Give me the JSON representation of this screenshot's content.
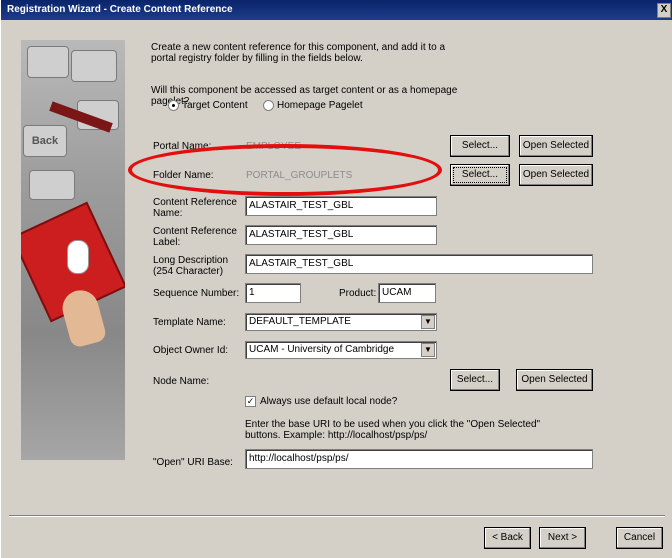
{
  "window": {
    "title": "Registration Wizard - Create Content Reference",
    "close": "X"
  },
  "intro": "Create a new content reference for this component, and add it to a portal registry folder by filling in the fields below.",
  "access_question": "Will this component be accessed as target content or as a homepage pagelet?",
  "radio": {
    "target": "Target Content",
    "homepage": "Homepage Pagelet",
    "selected": "target"
  },
  "portal_name": {
    "label": "Portal Name:",
    "value": "EMPLOYEE"
  },
  "folder_name": {
    "label": "Folder Name:",
    "value": "PORTAL_GROUPLETS"
  },
  "buttons": {
    "select": "Select...",
    "open_selected": "Open Selected"
  },
  "content_ref_name": {
    "label": "Content Reference Name:",
    "value": "ALASTAIR_TEST_GBL"
  },
  "content_ref_label": {
    "label": "Content Reference Label:",
    "value": "ALASTAIR_TEST_GBL"
  },
  "long_description": {
    "label": "Long Description (254 Character)",
    "value": "ALASTAIR_TEST_GBL"
  },
  "sequence_number": {
    "label": "Sequence Number:",
    "value": "1"
  },
  "product": {
    "label": "Product:",
    "value": "UCAM"
  },
  "template_name": {
    "label": "Template Name:",
    "value": "DEFAULT_TEMPLATE"
  },
  "object_owner": {
    "label": "Object Owner Id:",
    "value": "UCAM - University of Cambridge"
  },
  "node_name": {
    "label": "Node Name:"
  },
  "default_node": {
    "label": "Always use default local node?",
    "checked": true
  },
  "uri_help": "Enter the base URI to be used when you click the \"Open Selected\" buttons. Example: http://localhost/psp/ps/",
  "uri_base": {
    "label": "\"Open\" URI Base:",
    "value": "http://localhost/psp/ps/"
  },
  "footer": {
    "back": "< Back",
    "next": "Next >",
    "cancel": "Cancel"
  },
  "side_image": {
    "key_label": "Back"
  },
  "colors": {
    "titlebar": "#0a246a",
    "dialog": "#d4d0c8",
    "highlight": "#e30e0e"
  }
}
